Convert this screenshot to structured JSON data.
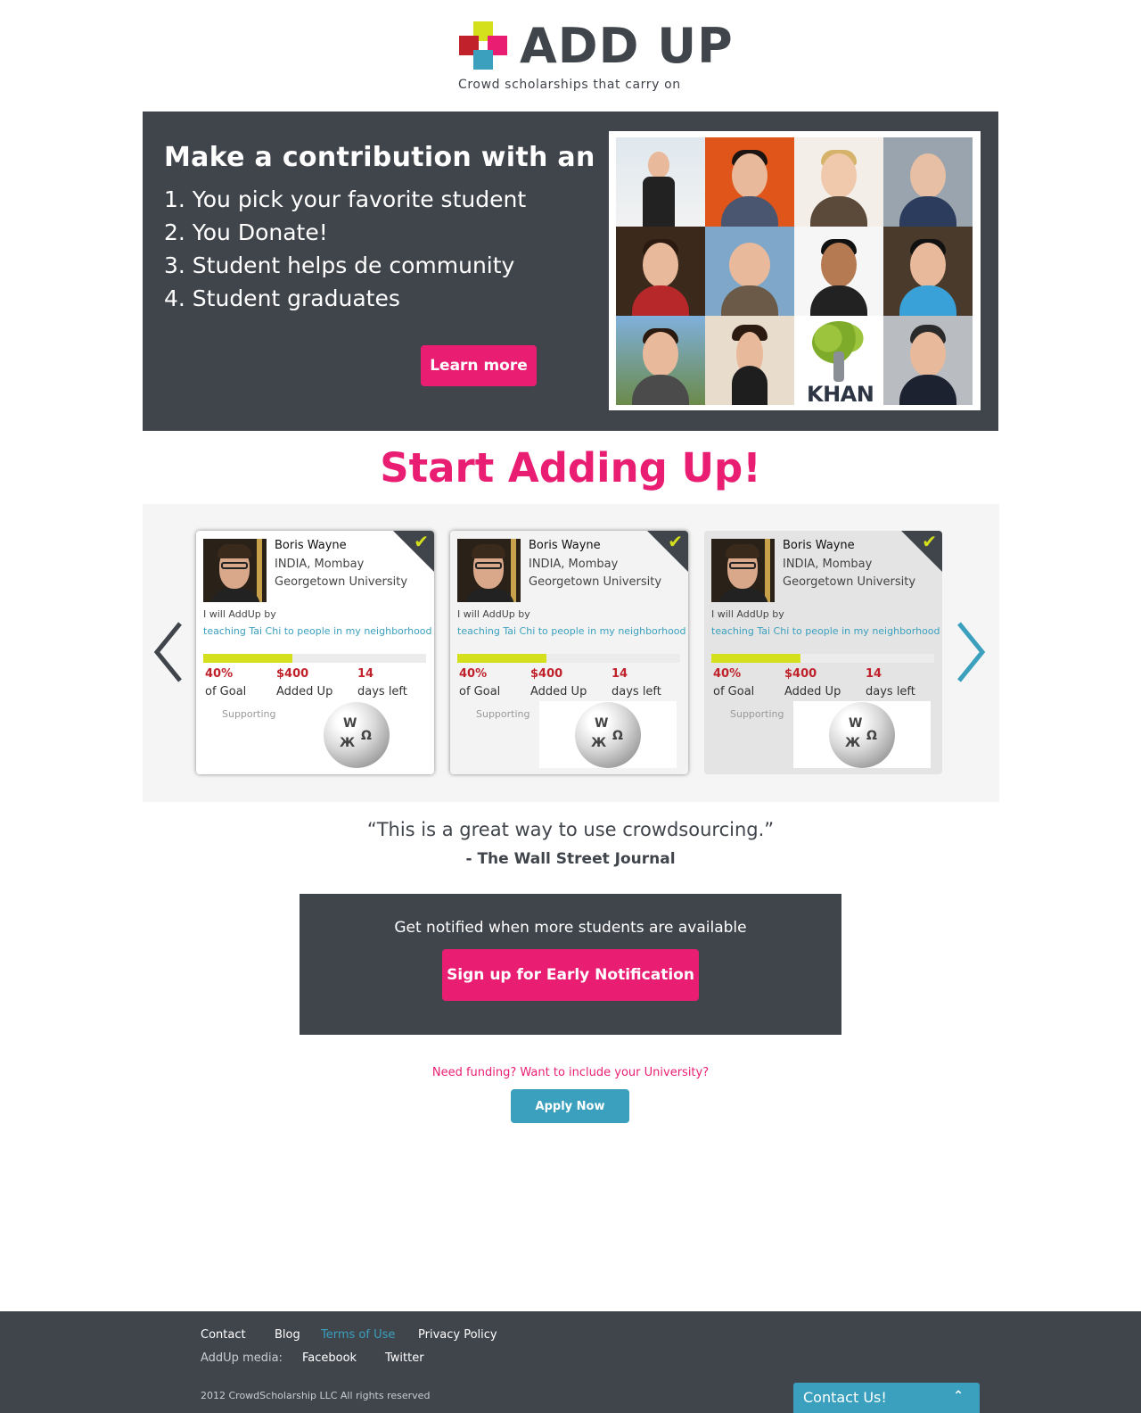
{
  "brand": {
    "name": "ADD UP",
    "tagline": "Crowd scholarships that carry on",
    "colors": {
      "pink": "#e91e73",
      "dark": "#40444b",
      "teal": "#3aa0bd",
      "lime": "#d4e01c",
      "red": "#c0212a"
    }
  },
  "hero": {
    "title": "Make a contribution with an",
    "steps": [
      "1. You pick your favorite student",
      "2. You Donate!",
      "3. Student helps de community",
      "4. Student graduates"
    ],
    "learn_more": "Learn more",
    "khan_label": "KHAN"
  },
  "section_title": "Start Adding Up!",
  "carousel": {
    "prev_icon": "chevron-left-icon",
    "next_icon": "chevron-right-icon",
    "cards": [
      {
        "name": "Boris Wayne",
        "location": "INDIA, Mombay",
        "university": "Georgetown University",
        "will_label": "I will AddUp by",
        "task": "teaching Tai Chi to people in my neighborhood",
        "progress": 0.4,
        "goal_value": "40%",
        "goal_label": "of Goal",
        "added_value": "$400",
        "added_label": "Added Up",
        "days_value": "14",
        "days_label": "days left",
        "supporting": "Supporting",
        "supported_org_icon": "wikipedia-globe-icon"
      },
      {
        "name": "Boris Wayne",
        "location": "INDIA, Mombay",
        "university": "Georgetown University",
        "will_label": "I will AddUp by",
        "task": "teaching Tai Chi to people in my neighborhood",
        "progress": 0.4,
        "goal_value": "40%",
        "goal_label": "of Goal",
        "added_value": "$400",
        "added_label": "Added Up",
        "days_value": "14",
        "days_label": "days left",
        "supporting": "Supporting",
        "supported_org_icon": "wikipedia-globe-icon"
      },
      {
        "name": "Boris Wayne",
        "location": "INDIA, Mombay",
        "university": "Georgetown University",
        "will_label": "I will AddUp by",
        "task": "teaching Tai Chi to people in my neighborhood",
        "progress": 0.4,
        "goal_value": "40%",
        "goal_label": "of Goal",
        "added_value": "$400",
        "added_label": "Added Up",
        "days_value": "14",
        "days_label": "days left",
        "supporting": "Supporting",
        "supported_org_icon": "wikipedia-globe-icon"
      }
    ]
  },
  "quote": {
    "text": "“This is a great way to use crowdsourcing.”",
    "source": "- The Wall Street Journal"
  },
  "notify": {
    "text": "Get notified when more students are available",
    "button": "Sign up for Early Notification"
  },
  "apply": {
    "text": "Need funding? Want to include your University?",
    "button": "Apply Now"
  },
  "footer": {
    "links": [
      "Contact",
      "Blog",
      "Terms of Use",
      "Privacy Policy"
    ],
    "media_label": "AddUp media:",
    "media_links": [
      "Facebook",
      "Twitter"
    ],
    "copyright": "2012 CrowdScholarship LLC All rights reserved",
    "contact_tab": "Contact Us!"
  }
}
